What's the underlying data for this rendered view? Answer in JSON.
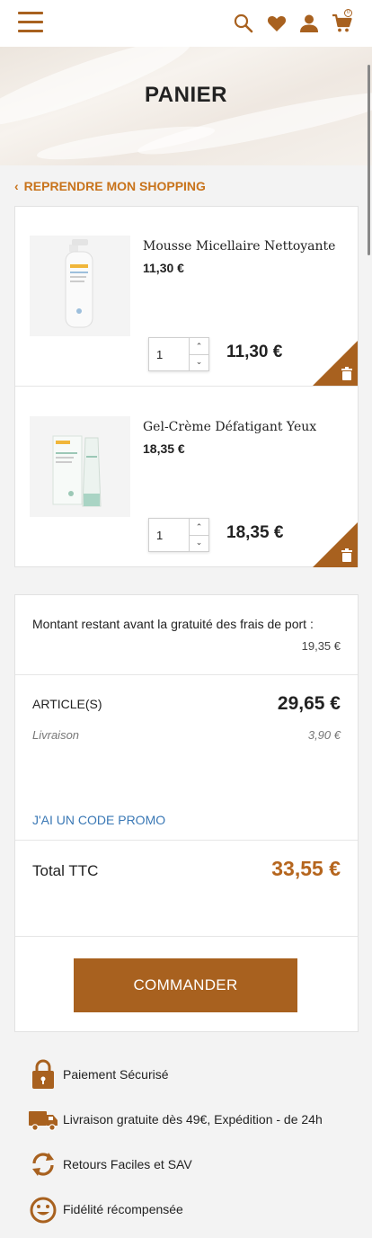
{
  "colors": {
    "brand": "#a8611f",
    "accent_price": "#b5651d",
    "link_blue": "#3a78b5",
    "back_link": "#c8731b"
  },
  "header": {
    "icons": [
      "menu-icon",
      "search-icon",
      "heart-icon",
      "user-icon",
      "cart-icon"
    ],
    "cart_count": "0"
  },
  "hero": {
    "title": "PANIER"
  },
  "back_link": {
    "label": "REPRENDRE MON SHOPPING"
  },
  "cart": {
    "items": [
      {
        "name": "Mousse Micellaire Nettoyante",
        "unit_price": "11,30 €",
        "quantity": "1",
        "line_total": "11,30 €"
      },
      {
        "name": "Gel-Crème Défatigant Yeux",
        "unit_price": "18,35 €",
        "quantity": "1",
        "line_total": "18,35 €"
      }
    ]
  },
  "summary": {
    "shipping_note": "Montant restant avant la gratuité des frais de port :",
    "shipping_remaining": "19,35 €",
    "articles_label": "ARTICLE(S)",
    "articles_total": "29,65 €",
    "delivery_label": "Livraison",
    "delivery_price": "3,90 €",
    "promo_label": "J'AI UN CODE PROMO",
    "total_label": "Total TTC",
    "total_value": "33,55 €",
    "order_button": "COMMANDER"
  },
  "reassurance": [
    {
      "icon": "lock-icon",
      "label": "Paiement Sécurisé"
    },
    {
      "icon": "truck-icon",
      "label": "Livraison gratuite dès 49€, Expédition - de 24h"
    },
    {
      "icon": "refresh-icon",
      "label": "Retours Faciles et SAV"
    },
    {
      "icon": "smile-icon",
      "label": "Fidélité récompensée"
    }
  ]
}
